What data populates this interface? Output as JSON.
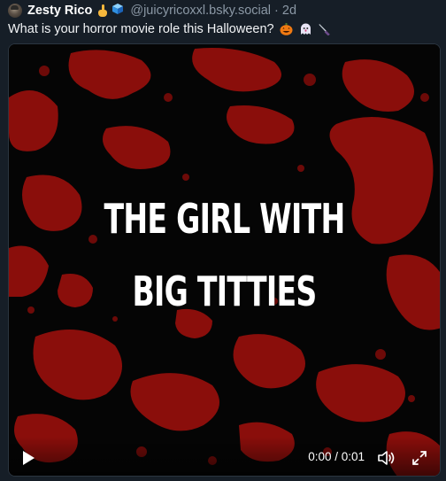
{
  "post": {
    "author": {
      "display_name": "Zesty Rico",
      "handle": "@juicyricoxxl.bsky.social",
      "avatar_icon": "avatar-photo"
    },
    "name_emojis": [
      "pointing-up-icon",
      "cube-icon"
    ],
    "separator": "·",
    "timestamp": "2d",
    "text": "What is your horror movie role this Halloween?",
    "text_emojis": [
      "jack-o-lantern-icon",
      "ghost-icon",
      "knife-icon"
    ]
  },
  "video": {
    "overlay_line_1": "THE GIRL WITH",
    "overlay_line_2": "BIG TITTIES",
    "time": "0:00 / 0:01",
    "play_icon": "play-icon",
    "volume_icon": "volume-icon",
    "fullscreen_icon": "fullscreen-icon",
    "splatter_color": "#8a0e0b",
    "background_color": "#050505"
  }
}
